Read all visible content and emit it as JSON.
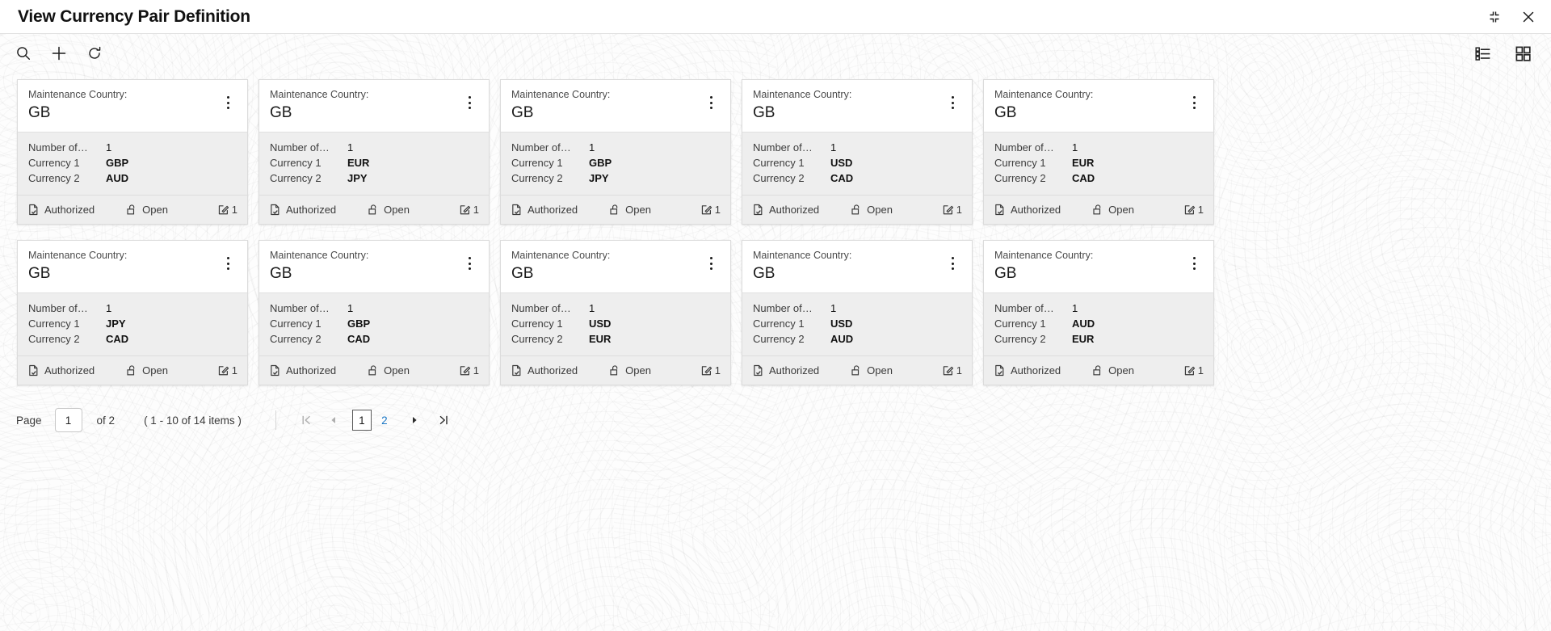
{
  "window": {
    "title": "View Currency Pair Definition",
    "minimize_icon": "collapse-icon",
    "close_icon": "close-icon"
  },
  "toolbar": {
    "search_icon": "search-icon",
    "add_icon": "plus-icon",
    "refresh_icon": "refresh-icon",
    "list_view_icon": "list-view-icon",
    "tile_view_icon": "tile-view-icon"
  },
  "card_template": {
    "header_label": "Maintenance Country:",
    "field_count_label": "Number of…",
    "field_ccy1_label": "Currency 1",
    "field_ccy2_label": "Currency 2",
    "kebab_icon": "more-options-icon",
    "auth_icon": "document-check-icon",
    "lock_icon": "unlocked-padlock-icon",
    "mod_icon": "edit-square-icon"
  },
  "cards": [
    {
      "country": "GB",
      "count": "1",
      "ccy1": "GBP",
      "ccy2": "AUD",
      "auth_status": "Authorized",
      "lock_status": "Open",
      "mod_no": "1"
    },
    {
      "country": "GB",
      "count": "1",
      "ccy1": "EUR",
      "ccy2": "JPY",
      "auth_status": "Authorized",
      "lock_status": "Open",
      "mod_no": "1"
    },
    {
      "country": "GB",
      "count": "1",
      "ccy1": "GBP",
      "ccy2": "JPY",
      "auth_status": "Authorized",
      "lock_status": "Open",
      "mod_no": "1"
    },
    {
      "country": "GB",
      "count": "1",
      "ccy1": "USD",
      "ccy2": "CAD",
      "auth_status": "Authorized",
      "lock_status": "Open",
      "mod_no": "1"
    },
    {
      "country": "GB",
      "count": "1",
      "ccy1": "EUR",
      "ccy2": "CAD",
      "auth_status": "Authorized",
      "lock_status": "Open",
      "mod_no": "1"
    },
    {
      "country": "GB",
      "count": "1",
      "ccy1": "JPY",
      "ccy2": "CAD",
      "auth_status": "Authorized",
      "lock_status": "Open",
      "mod_no": "1"
    },
    {
      "country": "GB",
      "count": "1",
      "ccy1": "GBP",
      "ccy2": "CAD",
      "auth_status": "Authorized",
      "lock_status": "Open",
      "mod_no": "1"
    },
    {
      "country": "GB",
      "count": "1",
      "ccy1": "USD",
      "ccy2": "EUR",
      "auth_status": "Authorized",
      "lock_status": "Open",
      "mod_no": "1"
    },
    {
      "country": "GB",
      "count": "1",
      "ccy1": "USD",
      "ccy2": "AUD",
      "auth_status": "Authorized",
      "lock_status": "Open",
      "mod_no": "1"
    },
    {
      "country": "GB",
      "count": "1",
      "ccy1": "AUD",
      "ccy2": "EUR",
      "auth_status": "Authorized",
      "lock_status": "Open",
      "mod_no": "1"
    }
  ],
  "pagination": {
    "page_label": "Page",
    "page_value": "1",
    "of_text": "of 2",
    "items_text": "( 1 - 10 of 14 items )",
    "first_icon": "first-page-icon",
    "prev_icon": "prev-page-icon",
    "next_icon": "next-page-icon",
    "last_icon": "last-page-icon",
    "pages": [
      "1",
      "2"
    ],
    "current_page": "1",
    "link_color": "#1a76c4"
  }
}
